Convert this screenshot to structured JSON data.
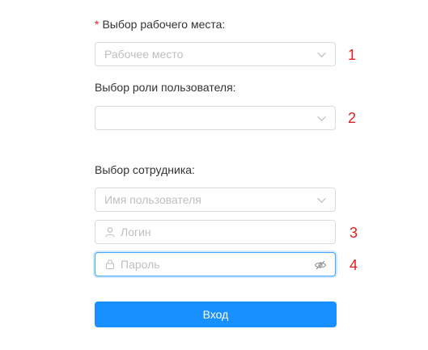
{
  "workplace": {
    "required_mark": "*",
    "label": "Выбор рабочего места:",
    "placeholder": "Рабочее место",
    "annotation": "1"
  },
  "role": {
    "label": "Выбор роли пользователя:",
    "placeholder": "",
    "annotation": "2"
  },
  "employee": {
    "label": "Выбор сотрудника:",
    "username_placeholder": "Имя пользователя",
    "login_placeholder": "Логин",
    "login_annotation": "3",
    "password_placeholder": "Пароль",
    "password_annotation": "4"
  },
  "submit_label": "Вход",
  "colors": {
    "primary": "#1890ff",
    "annotation": "#e02020",
    "required": "#f5222d"
  }
}
